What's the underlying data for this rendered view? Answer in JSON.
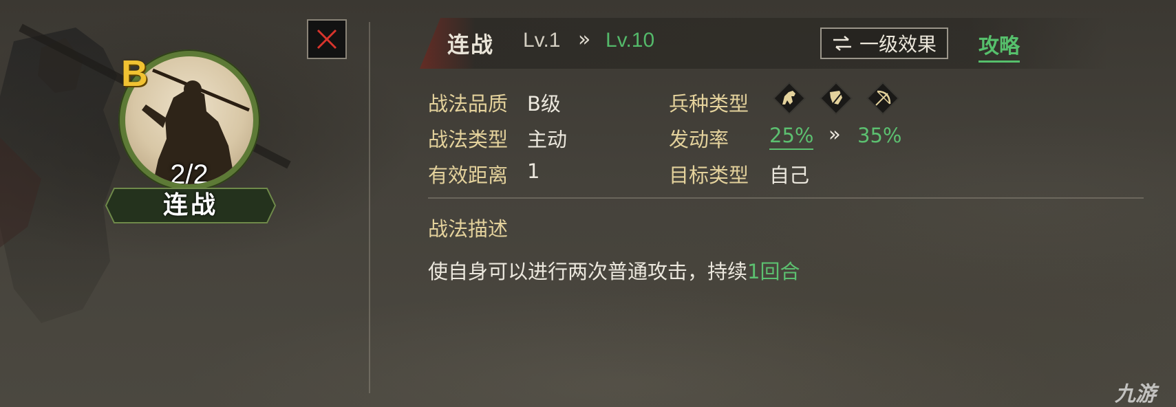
{
  "close_button": {
    "icon": "close-icon",
    "accent": "#d8342c"
  },
  "skill_card": {
    "grade": "B",
    "uses": "2/2",
    "name": "连战"
  },
  "header": {
    "title": "连战",
    "level_current": "Lv.1",
    "level_arrow": "»",
    "level_max": "Lv.10",
    "effect_button_label": "一级效果",
    "effect_button_icon": "swap-arrows-icon",
    "guide_link": "攻略"
  },
  "attributes": {
    "quality_label": "战法品质",
    "quality_value": "B级",
    "type_label": "战法类型",
    "type_value": "主动",
    "range_label": "有效距离",
    "range_value": "1",
    "troop_label": "兵种类型",
    "troop_icons": [
      "cavalry-icon",
      "shield-icon",
      "archer-icon"
    ],
    "rate_label": "发动率",
    "rate_min": "25%",
    "rate_arrow": "»",
    "rate_max": "35%",
    "target_label": "目标类型",
    "target_value": "自己"
  },
  "description": {
    "title": "战法描述",
    "text_main": "使自身可以进行两次普通攻击，持续",
    "text_highlight": "1回合"
  },
  "watermark": "九游",
  "colors": {
    "highlight_green": "#5cc070",
    "label_gold": "#e4d29c",
    "grade_gold": "#f1c232",
    "medallion_green": "#5d7a36"
  }
}
